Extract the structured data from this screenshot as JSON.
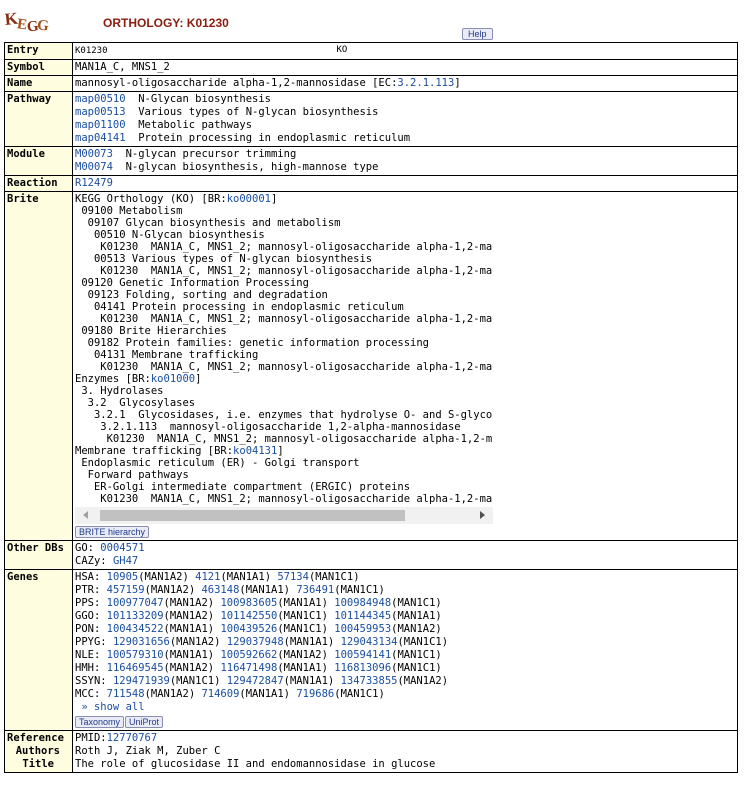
{
  "header": {
    "title": "ORTHOLOGY: K01230",
    "help_label": "Help",
    "logo_text": "KEGG"
  },
  "entry": {
    "label": "Entry",
    "id": "K01230",
    "type": "KO"
  },
  "symbol": {
    "label": "Symbol",
    "value": "MAN1A_C, MNS1_2"
  },
  "name": {
    "label": "Name",
    "prefix": "mannosyl-oligosaccharide alpha-1,2-mannosidase [EC:",
    "ec": "3.2.1.113",
    "suffix": "]"
  },
  "pathway": {
    "label": "Pathway",
    "items": [
      {
        "id": "map00510",
        "desc": "N-Glycan biosynthesis"
      },
      {
        "id": "map00513",
        "desc": "Various types of N-glycan biosynthesis"
      },
      {
        "id": "map01100",
        "desc": "Metabolic pathways"
      },
      {
        "id": "map04141",
        "desc": "Protein processing in endoplasmic reticulum"
      }
    ]
  },
  "module": {
    "label": "Module",
    "items": [
      {
        "id": "M00073",
        "desc": "N-glycan precursor trimming"
      },
      {
        "id": "M00074",
        "desc": "N-glycan biosynthesis, high-mannose type"
      }
    ]
  },
  "reaction": {
    "label": "Reaction",
    "value": "R12479"
  },
  "brite": {
    "label": "Brite",
    "button": "BRITE hierarchy",
    "l1_pre": "KEGG Orthology (KO) [BR:",
    "l1_link": "ko00001",
    "l1_post": "]",
    "l2": " 09100 Metabolism",
    "l3": "  09107 Glycan biosynthesis and metabolism",
    "l4": "   00510 N-Glycan biosynthesis",
    "l5": "    K01230  MAN1A_C, MNS1_2; mannosyl-oligosaccharide alpha-1,2-ma",
    "l6": "   00513 Various types of N-glycan biosynthesis",
    "l7": "    K01230  MAN1A_C, MNS1_2; mannosyl-oligosaccharide alpha-1,2-ma",
    "l8": " 09120 Genetic Information Processing",
    "l9": "  09123 Folding, sorting and degradation",
    "l10": "   04141 Protein processing in endoplasmic reticulum",
    "l11": "    K01230  MAN1A_C, MNS1_2; mannosyl-oligosaccharide alpha-1,2-ma",
    "l12": " 09180 Brite Hierarchies",
    "l13": "  09182 Protein families: genetic information processing",
    "l14": "   04131 Membrane trafficking",
    "l15": "    K01230  MAN1A_C, MNS1_2; mannosyl-oligosaccharide alpha-1,2-ma",
    "l16_pre": "Enzymes [BR:",
    "l16_link": "ko01000",
    "l16_post": "]",
    "l17": " 3. Hydrolases",
    "l18": "  3.2  Glycosylases",
    "l19": "   3.2.1  Glycosidases, i.e. enzymes that hydrolyse O- and S-glyco",
    "l20": "    3.2.1.113  mannosyl-oligosaccharide 1,2-alpha-mannosidase",
    "l21": "     K01230  MAN1A_C, MNS1_2; mannosyl-oligosaccharide alpha-1,2-m",
    "l22_pre": "Membrane trafficking [BR:",
    "l22_link": "ko04131",
    "l22_post": "]",
    "l23": " Endoplasmic reticulum (ER) - Golgi transport",
    "l24": "  Forward pathways",
    "l25": "   ER-Golgi intermediate compartment (ERGIC) proteins",
    "l26": "    K01230  MAN1A_C, MNS1_2; mannosyl-oligosaccharide alpha-1,2-ma"
  },
  "other_dbs": {
    "label": "Other DBs",
    "items": [
      {
        "db": "GO: ",
        "id": "0004571"
      },
      {
        "db": "CAZy: ",
        "id": "GH47"
      }
    ]
  },
  "genes": {
    "label": "Genes",
    "show_all": "» show all",
    "taxonomy_btn": "Taxonomy",
    "uniprot_btn": "UniProt",
    "rows": [
      {
        "org": "HSA:",
        "g": [
          [
            "10905",
            "(MAN1A2)"
          ],
          [
            "4121",
            "(MAN1A1)"
          ],
          [
            "57134",
            "(MAN1C1)"
          ]
        ]
      },
      {
        "org": "PTR:",
        "g": [
          [
            "457159",
            "(MAN1A2)"
          ],
          [
            "463148",
            "(MAN1A1)"
          ],
          [
            "736491",
            "(MAN1C1)"
          ]
        ]
      },
      {
        "org": "PPS:",
        "g": [
          [
            "100977047",
            "(MAN1A2)"
          ],
          [
            "100983605",
            "(MAN1A1)"
          ],
          [
            "100984948",
            "(MAN1C1)"
          ]
        ]
      },
      {
        "org": "GGO:",
        "g": [
          [
            "101133209",
            "(MAN1A2)"
          ],
          [
            "101142550",
            "(MAN1C1)"
          ],
          [
            "101144345",
            "(MAN1A1)"
          ]
        ]
      },
      {
        "org": "PON:",
        "g": [
          [
            "100434522",
            "(MAN1A1)"
          ],
          [
            "100439526",
            "(MAN1C1)"
          ],
          [
            "100459953",
            "(MAN1A2)"
          ]
        ]
      },
      {
        "org": "PPYG:",
        "g": [
          [
            "129031656",
            "(MAN1A2)"
          ],
          [
            "129037948",
            "(MAN1A1)"
          ],
          [
            "129043134",
            "(MAN1C1)"
          ]
        ]
      },
      {
        "org": "NLE:",
        "g": [
          [
            "100579310",
            "(MAN1A1)"
          ],
          [
            "100592662",
            "(MAN1A2)"
          ],
          [
            "100594141",
            "(MAN1C1)"
          ]
        ]
      },
      {
        "org": "HMH:",
        "g": [
          [
            "116469545",
            "(MAN1A2)"
          ],
          [
            "116471498",
            "(MAN1A1)"
          ],
          [
            "116813096",
            "(MAN1C1)"
          ]
        ]
      },
      {
        "org": "SSYN:",
        "g": [
          [
            "129471939",
            "(MAN1C1)"
          ],
          [
            "129472847",
            "(MAN1A1)"
          ],
          [
            "134733855",
            "(MAN1A2)"
          ]
        ]
      },
      {
        "org": "MCC:",
        "g": [
          [
            "711548",
            "(MAN1A2)"
          ],
          [
            "714609",
            "(MAN1A1)"
          ],
          [
            "719686",
            "(MAN1C1)"
          ]
        ]
      }
    ]
  },
  "reference": {
    "label": "Reference",
    "pmid_prefix": "PMID:",
    "pmid": "12770767",
    "authors_label": "Authors",
    "authors": "Roth J, Ziak M, Zuber C",
    "title_label": "Title",
    "title": "The role of glucosidase II and endomannosidase in glucose"
  }
}
